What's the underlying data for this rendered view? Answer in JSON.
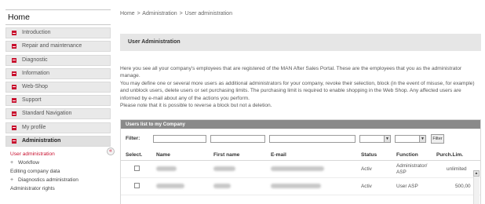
{
  "sidebar": {
    "home_label": "Home",
    "items": [
      {
        "label": "Introduction"
      },
      {
        "label": "Repair and maintenance"
      },
      {
        "label": "Diagnostic"
      },
      {
        "label": "Information"
      },
      {
        "label": "Web-Shop"
      },
      {
        "label": "Support"
      },
      {
        "label": "Standard Navigation"
      },
      {
        "label": "My profile"
      },
      {
        "label": "Administration"
      }
    ],
    "collapse_glyph": "«",
    "subitems": [
      {
        "label": "User administration",
        "prefix": ""
      },
      {
        "label": "Workflow",
        "prefix": "+"
      },
      {
        "label": "Editing company data",
        "prefix": ""
      },
      {
        "label": "Diagnostics administration",
        "prefix": "+"
      },
      {
        "label": "Administrator rights",
        "prefix": ""
      }
    ]
  },
  "breadcrumb": {
    "home": "Home",
    "admin": "Administration",
    "current": "User administration",
    "separator": ">"
  },
  "page_title": "User Administration",
  "description": [
    "Here you see all your company's employees that are registered of the MAN After Sales Portal. These are the employees that you as the administrator manage.",
    "You may define one or several more users as additional administrators for your company, revoke their selection, block (in the event of misuse, for example) and unblock users, delete users or set purchasing limits. The purchasing limit is required to enable shopping in the Web Shop. Any affected users are informed by e-mail about any of the actions you perform.",
    "Please note that it is possible to reverse a block but not a deletion."
  ],
  "users_panel": {
    "header": "Users list to my Company",
    "filter_label": "Filter:",
    "filter_button": "Filter",
    "arrow_glyph": "▼",
    "scroll_up_glyph": "▲",
    "columns": [
      "Select.",
      "Name",
      "First name",
      "E-mail",
      "Status",
      "Function",
      "Purch.Lim."
    ],
    "rows": [
      {
        "status": "Activ",
        "function": "Administrator/ ASP",
        "limit": "unlimited"
      },
      {
        "status": "Activ",
        "function": "User ASP",
        "limit": "500,00"
      }
    ]
  },
  "colors": {
    "brand_red": "#c8102e",
    "header_gray": "#8a8a8a",
    "title_bar_gray": "#e6e6e6"
  }
}
